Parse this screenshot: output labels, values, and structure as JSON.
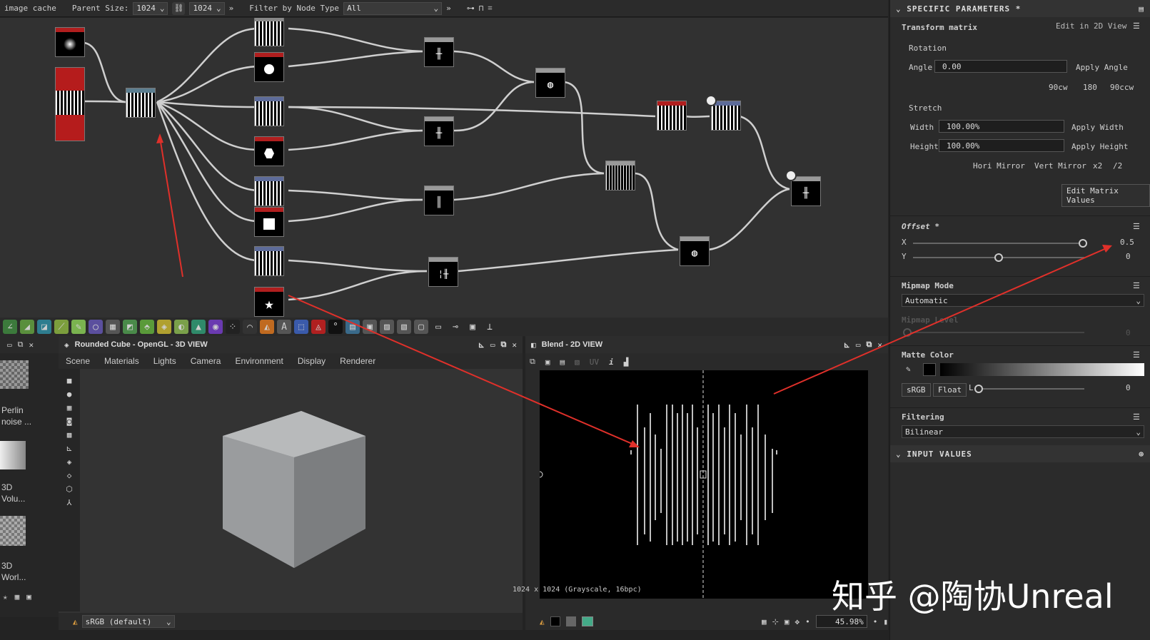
{
  "graph_toolbar": {
    "cache_label": "image cache",
    "parent_size_label": "Parent Size:",
    "parent_size_value": "1024",
    "size_value": "1024",
    "filter_label": "Filter by Node Type",
    "filter_value": "All"
  },
  "view3d": {
    "title": "Rounded Cube - OpenGL - 3D VIEW",
    "menu": [
      "Scene",
      "Materials",
      "Lights",
      "Camera",
      "Environment",
      "Display",
      "Renderer"
    ],
    "colorspace": "sRGB (default)"
  },
  "library": {
    "items": [
      "Perlin\nnoise ...",
      "3D\nVolu...",
      "3D\nWorl..."
    ]
  },
  "view2d": {
    "title": "Blend - 2D VIEW",
    "uv_label": "UV",
    "info": "1024 x 1024 (Grayscale, 16bpc)",
    "zoom": "45.98%"
  },
  "props": {
    "header": "SPECIFIC PARAMETERS *",
    "transform_label": "Transform matrix",
    "edit_2d": "Edit in 2D View",
    "rotation_label": "Rotation",
    "angle_label": "Angle",
    "angle_value": "0.00",
    "apply_angle": "Apply Angle",
    "rot_buttons": [
      "90cw",
      "180",
      "90ccw"
    ],
    "stretch_label": "Stretch",
    "width_label": "Width",
    "width_value": "100.00%",
    "apply_width": "Apply Width",
    "height_label": "Height",
    "height_value": "100.00%",
    "apply_height": "Apply Height",
    "mirror_buttons": [
      "Hori Mirror",
      "Vert Mirror",
      "x2",
      "/2"
    ],
    "edit_matrix": "Edit Matrix Values",
    "offset_label": "Offset *",
    "x_label": "X",
    "x_value": "0.5",
    "y_label": "Y",
    "y_value": "0",
    "mipmap_mode_label": "Mipmap Mode",
    "mipmap_mode_value": "Automatic",
    "mipmap_level_label": "Mipmap Level",
    "mipmap_level_value": "0",
    "matte_label": "Matte Color",
    "srgb_btn": "sRGB",
    "float_btn": "Float",
    "matte_l": "L",
    "matte_value": "0",
    "filtering_label": "Filtering",
    "filtering_value": "Bilinear",
    "input_values": "INPUT VALUES"
  },
  "watermark": "知乎 @陶协Unreal",
  "colors": {
    "accent_red": "#e0302a",
    "panel": "#2b2b2b",
    "graph_bg": "#313131"
  }
}
